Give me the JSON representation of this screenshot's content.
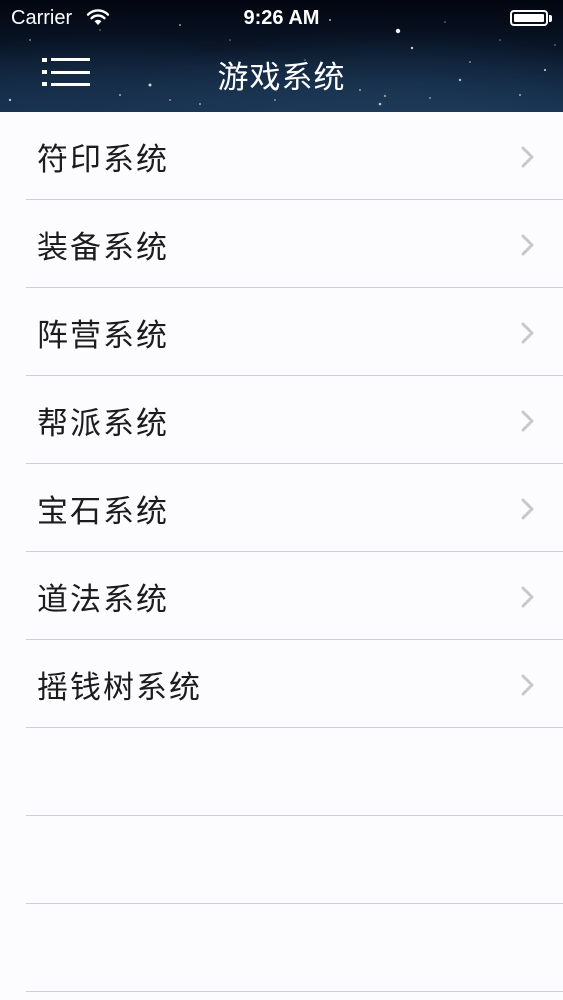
{
  "status_bar": {
    "carrier": "Carrier",
    "time": "9:26 AM",
    "wifi_icon": "wifi-icon",
    "battery_icon": "battery-icon",
    "battery_level": 1.0
  },
  "nav": {
    "title": "游戏系统",
    "menu_icon": "hamburger-menu-icon"
  },
  "list": {
    "items": [
      {
        "label": "符印系统"
      },
      {
        "label": "装备系统"
      },
      {
        "label": "阵营系统"
      },
      {
        "label": "帮派系统"
      },
      {
        "label": "宝石系统"
      },
      {
        "label": "道法系统"
      },
      {
        "label": "摇钱树系统"
      }
    ],
    "chevron_icon": "chevron-right-icon"
  },
  "colors": {
    "header_background": "#0a1628",
    "list_background": "#fcfcfe",
    "divider": "#cfcfd3",
    "chevron": "#c7c7cc",
    "label_text": "#1c1c1c"
  }
}
